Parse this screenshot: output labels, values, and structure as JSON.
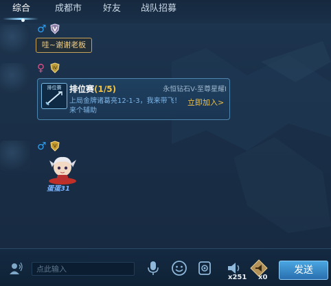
{
  "tabs": [
    {
      "label": "综合",
      "active": true
    },
    {
      "label": "成都市",
      "active": false
    },
    {
      "label": "好友",
      "active": false
    },
    {
      "label": "战队招募",
      "active": false
    }
  ],
  "messages": [
    {
      "gender": "♂",
      "rank_icon": "rank-badge-icon",
      "bubble_text": "哇~谢谢老板"
    },
    {
      "gender": "♀",
      "rank_icon": "rank-badge-iv-icon",
      "card": {
        "icon_label": "排位赛",
        "title": "排位赛",
        "count": "(1/5)",
        "rank_range": "永恒钻石V-至尊星耀I",
        "description": "上局金牌诸葛亮12-1-3，我来带飞！ 来个辅助",
        "join": "立即加入>"
      }
    },
    {
      "gender": "♂",
      "rank_icon": "rank-badge-v-icon",
      "hero_name": "蛋蛋31"
    }
  ],
  "input": {
    "placeholder": "点此输入"
  },
  "toolbar": {
    "speaker_count": "x251",
    "horn_count": "x0",
    "send_label": "发送"
  },
  "colors": {
    "accent": "#4aa6e0",
    "gold": "#f0c24a",
    "male": "#2fa0f0",
    "female": "#e0538a"
  }
}
